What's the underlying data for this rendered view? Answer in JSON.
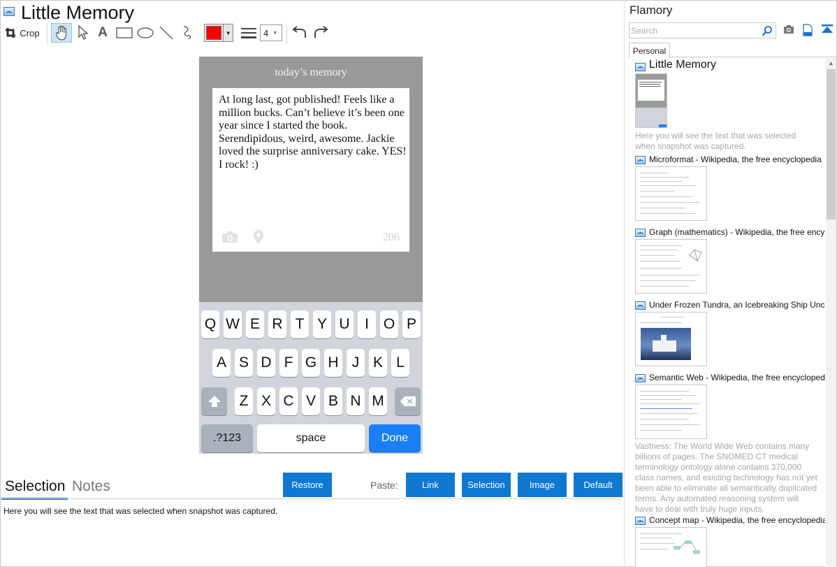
{
  "app": {
    "title": "Little Memory",
    "crop_label": "Crop",
    "text_tool_glyph": "A",
    "line_width_value": "4",
    "pen_color": "#ff0000",
    "accent_color": "#0f78d1"
  },
  "phone": {
    "header": "today’s memory",
    "memory_text": "At long last, got published! Feels like a million bucks. Can’t believe it’s been one year since I started the book. Serendipidous, weird, awesome. Jackie loved the surprise anniversary cake. YES! I rock! :)",
    "char_count": "206",
    "keyboard": {
      "row1": [
        "Q",
        "W",
        "E",
        "R",
        "T",
        "Y",
        "U",
        "I",
        "O",
        "P"
      ],
      "row2": [
        "A",
        "S",
        "D",
        "F",
        "G",
        "H",
        "J",
        "K",
        "L"
      ],
      "row3": [
        "Z",
        "X",
        "C",
        "V",
        "B",
        "N",
        "M"
      ],
      "numbers_key": ".?123",
      "space_key": "space",
      "done_key": "Done"
    }
  },
  "bottom": {
    "tabs": [
      "Selection",
      "Notes"
    ],
    "restore_label": "Restore",
    "paste_label": "Paste:",
    "paste_buttons": [
      "Link",
      "Selection",
      "Image",
      "Default"
    ],
    "selection_text": "Here you will see the text that was selected when snapshot was captured."
  },
  "sidebar": {
    "title": "Flamory",
    "search_placeholder": "Search",
    "tab_personal": "Personal",
    "items": [
      {
        "title": "Little Memory",
        "desc": "Here you will see the text that was selected when snapshot was captured."
      },
      {
        "title": "Microformat - Wikipedia, the free encyclopedia"
      },
      {
        "title": "Graph (mathematics) - Wikipedia, the free encyclopedia"
      },
      {
        "title": "Under Frozen Tundra, an Icebreaking Ship Uncovers"
      },
      {
        "title": "Semantic Web - Wikipedia, the free encyclopedia",
        "desc": "Vastness: The World Wide Web contains many billions of pages. The SNOMED CT medical terminology ontology alone contains 370,000 class names, and existing technology has not yet been able to eliminate all semantically duplicated terms. Any automated reasoning system will have to deal with truly huge inputs."
      },
      {
        "title": "Concept map - Wikipedia, the free encyclopedia"
      }
    ]
  }
}
